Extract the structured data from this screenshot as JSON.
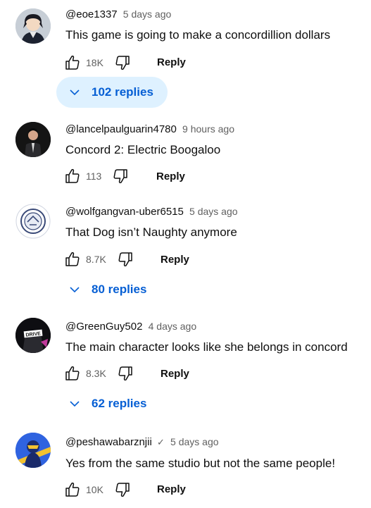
{
  "colors": {
    "link": "#065fd4",
    "muted": "#606060",
    "text": "#0f0f0f",
    "highlight": "#def1ff"
  },
  "icons": {
    "like": "thumb-up-icon",
    "dislike": "thumb-down-icon",
    "expand": "chevron-down-icon",
    "verified": "check-icon"
  },
  "comments": [
    {
      "author": "@eoe1337",
      "time": "5 days ago",
      "text": "This game is going to make a concordillion dollars",
      "likes": "18K",
      "reply": "Reply",
      "replies": "102 replies"
    },
    {
      "author": "@lancelpaulguarin4780",
      "time": "9 hours ago",
      "text": "Concord 2: Electric Boogaloo",
      "likes": "113",
      "reply": "Reply"
    },
    {
      "author": "@wolfgangvan-uber6515",
      "time": "5 days ago",
      "text": "That Dog isn’t Naughty anymore",
      "likes": "8.7K",
      "reply": "Reply",
      "replies": "80 replies"
    },
    {
      "author": "@GreenGuy502",
      "time": "4 days ago",
      "text": "The main character looks like she belongs in concord",
      "likes": "8.3K",
      "reply": "Reply",
      "replies": "62 replies",
      "avatar_text": "DRIVE"
    },
    {
      "author": "@peshawabarznjii",
      "verified": "✓",
      "time": "5 days ago",
      "text": "Yes from the same studio but not the same people!",
      "likes": "10K",
      "reply": "Reply"
    }
  ]
}
